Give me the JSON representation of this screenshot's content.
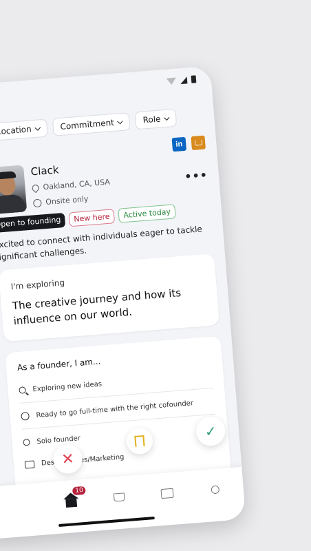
{
  "filters": [
    {
      "label": "Location"
    },
    {
      "label": "Commitment"
    },
    {
      "label": "Role"
    }
  ],
  "social": {
    "linkedin_label": "in"
  },
  "profile": {
    "name": "Clack",
    "location": "Oakland, CA, USA",
    "work_mode": "Onsite only",
    "more_label": "•••"
  },
  "badges": [
    {
      "label": "Open to founding"
    },
    {
      "label": "New here"
    },
    {
      "label": "Active today"
    }
  ],
  "bio": "Excited to connect with individuals eager to tackle significant challenges.",
  "exploring": {
    "label": "I'm exploring",
    "text": "The creative journey and how its influence on our world."
  },
  "founder": {
    "header": "As a founder, I am...",
    "items": [
      {
        "icon": "search-icon",
        "text": "Exploring new ideas"
      },
      {
        "icon": "timer-icon",
        "text": "Ready to go full-time with the right cofounder"
      },
      {
        "icon": "person-icon",
        "text": "Solo founder"
      },
      {
        "icon": "folder-icon",
        "text": "Design, Sales/Marketing"
      }
    ]
  },
  "actions": {
    "reject": "✕",
    "accept": "✓"
  },
  "tabbar": {
    "home_badge": "10"
  },
  "colors": {
    "accent_red": "#b3233b",
    "accent_green": "#2a8a3e",
    "linkedin": "#0a66c2",
    "coffee": "#d88a1d"
  }
}
